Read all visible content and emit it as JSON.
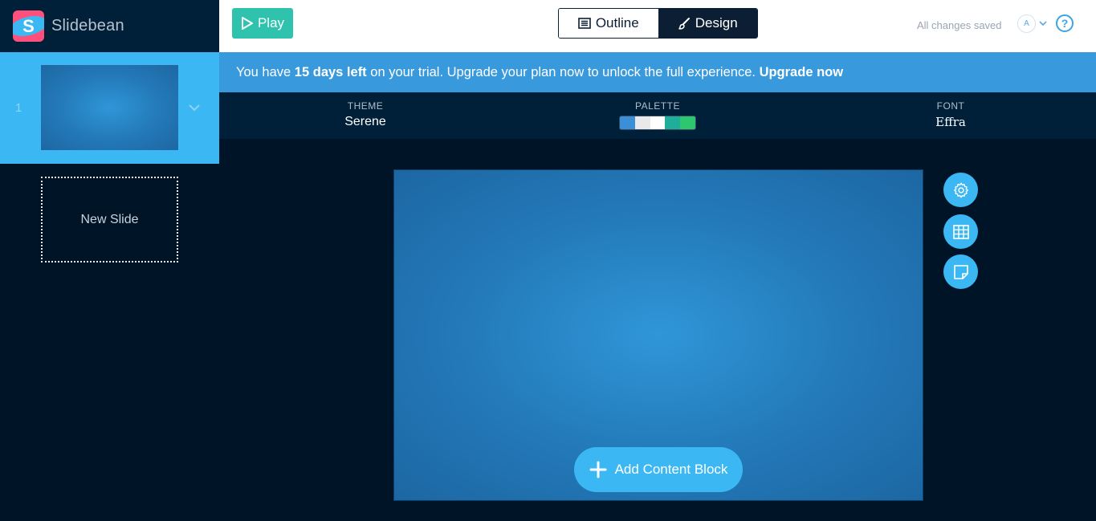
{
  "app": {
    "name": "Slidebean",
    "logo_letter": "S"
  },
  "toolbar": {
    "play_label": "Play",
    "outline_label": "Outline",
    "design_label": "Design",
    "status": "All changes saved",
    "avatar_initial": "A",
    "help_label": "?"
  },
  "banner": {
    "prefix": "You have ",
    "days_left": "15 days left",
    "middle": " on your trial. Upgrade your plan now to unlock the full experience. ",
    "upgrade_link": "Upgrade now"
  },
  "design": {
    "theme_label": "THEME",
    "theme_value": "Serene",
    "palette_label": "PALETTE",
    "palette_colors": [
      "#3a8fd6",
      "#e9e9e9",
      "#ffffff",
      "#1fae9a",
      "#2dc76d"
    ],
    "font_label": "FONT",
    "font_value": "Effra"
  },
  "slides": [
    {
      "number": "1"
    }
  ],
  "new_slide_label": "New Slide",
  "canvas": {
    "add_block_label": "Add Content Block"
  },
  "side_tools": [
    "gear-icon",
    "grid-icon",
    "note-icon"
  ],
  "colors": {
    "accent": "#3bb8f3",
    "play": "#2fc3ad",
    "banner": "#3899dc",
    "dark": "#001428"
  }
}
